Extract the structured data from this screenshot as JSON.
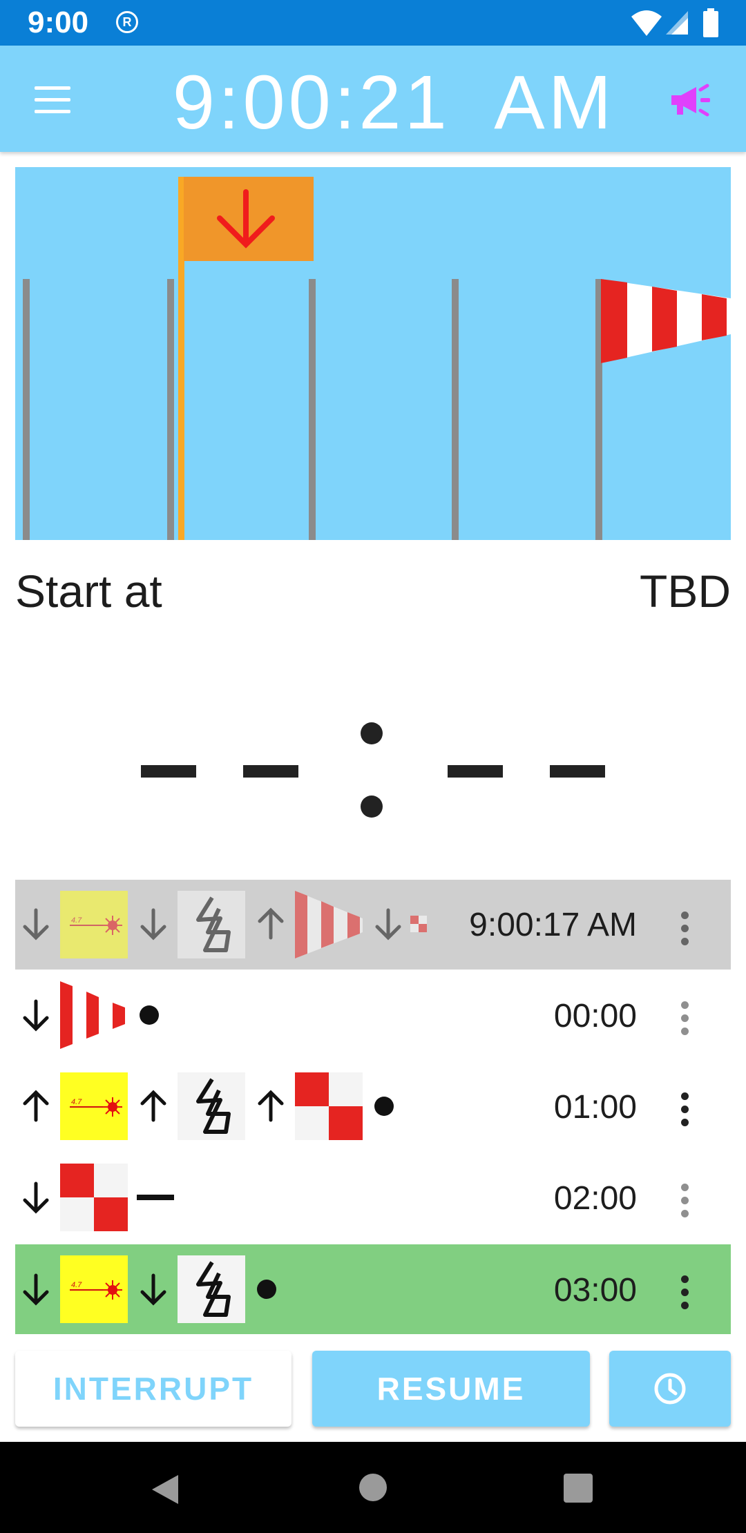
{
  "status_bar": {
    "time": "9:00",
    "notification_icon": "R"
  },
  "app_bar": {
    "clock": "9:00:21 AM",
    "menu_icon": "hamburger-menu-icon",
    "horn_icon": "megaphone-icon",
    "horn_color": "#e040fb"
  },
  "scene": {
    "background_color": "#7fd4fb",
    "pole_color": "#8b8b8b",
    "active_pole_color": "#f9a825",
    "flag_color": "#f0962a",
    "flag_arrow": "down-arrow-icon",
    "windsock_colors": [
      "#e52421",
      "#ffffff"
    ]
  },
  "start": {
    "label": "Start at",
    "value": "TBD"
  },
  "countdown": {
    "display": "--:--"
  },
  "sequence": {
    "rows": [
      {
        "time": "9:00:17 AM",
        "state": "done",
        "background": "#cfcfcf",
        "signals": [
          "down",
          "laser-flag",
          "down",
          "lightning-flag",
          "up",
          "windsock",
          "down",
          "small-checker"
        ]
      },
      {
        "time": "00:00",
        "state": "upcoming",
        "signals": [
          "down",
          "windsock",
          "dot"
        ]
      },
      {
        "time": "01:00",
        "state": "upcoming",
        "signals": [
          "up",
          "laser-flag",
          "up",
          "lightning-flag",
          "up",
          "checker-flag",
          "dot"
        ]
      },
      {
        "time": "02:00",
        "state": "upcoming",
        "signals": [
          "down",
          "checker-flag",
          "dash"
        ]
      },
      {
        "time": "03:00",
        "state": "current",
        "background": "#81cf81",
        "signals": [
          "down",
          "laser-flag",
          "down",
          "lightning-flag",
          "dot"
        ]
      }
    ],
    "laser_flag_text": "4.7"
  },
  "buttons": {
    "interrupt": "INTERRUPT",
    "resume": "RESUME",
    "clock_icon": "clock-icon"
  },
  "nav_bar": {
    "back": "back-icon",
    "home": "home-icon",
    "recents": "recents-icon"
  }
}
